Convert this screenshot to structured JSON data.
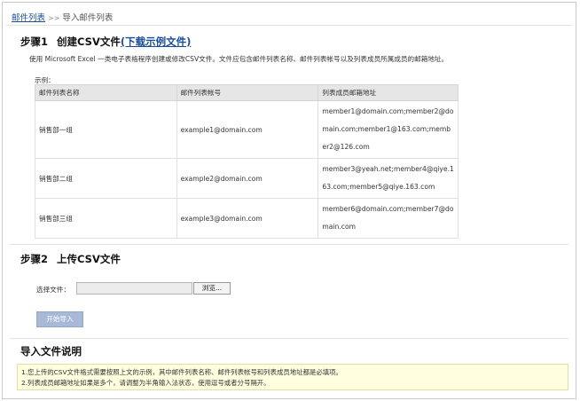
{
  "breadcrumb": {
    "parent": "邮件列表",
    "separator": ">>",
    "current": "导入邮件列表"
  },
  "step1": {
    "number": "步骤1",
    "title": "创建CSV文件",
    "download_link": "(下载示例文件)",
    "description": "使用 Microsoft Excel 一类电子表格程序创建或修改CSV文件。文件应包含邮件列表名称、邮件列表帐号以及列表成员所属成员的邮箱地址。",
    "example_label": "示例：",
    "table": {
      "headers": [
        "邮件列表名称",
        "邮件列表帐号",
        "列表成员邮箱地址"
      ],
      "rows": [
        {
          "name": "销售部一组",
          "account": "example1@domain.com",
          "members": "member1@domain.com;member2@domain.com;member1@163.com;member2@126.com"
        },
        {
          "name": "销售部二组",
          "account": "example2@domain.com",
          "members": "member3@yeah.net;member4@qiye.163.com;member5@qiye.163.com"
        },
        {
          "name": "销售部三组",
          "account": "example3@domain.com",
          "members": "member6@domain.com;member7@domain.com"
        }
      ]
    }
  },
  "step2": {
    "number": "步骤2",
    "title": "上传CSV文件",
    "file_label": "选择文件：",
    "file_value": "",
    "browse_label": "浏览...",
    "start_label": "开始导入"
  },
  "notes": {
    "title": "导入文件说明",
    "lines": [
      "1.您上传的CSV文件格式需要按照上文的示例，其中邮件列表名称、邮件列表帐号和列表成员地址都是必填项。",
      "2.列表成员邮箱地址如果是多个，请调整为半角输入法状态，使用逗号或者分号隔开。"
    ]
  },
  "colors": {
    "link": "#1a4d99",
    "header_bg": "#e6e6e6",
    "start_button_bg": "#a7b9d6",
    "note_bg": "#ffffe0"
  }
}
